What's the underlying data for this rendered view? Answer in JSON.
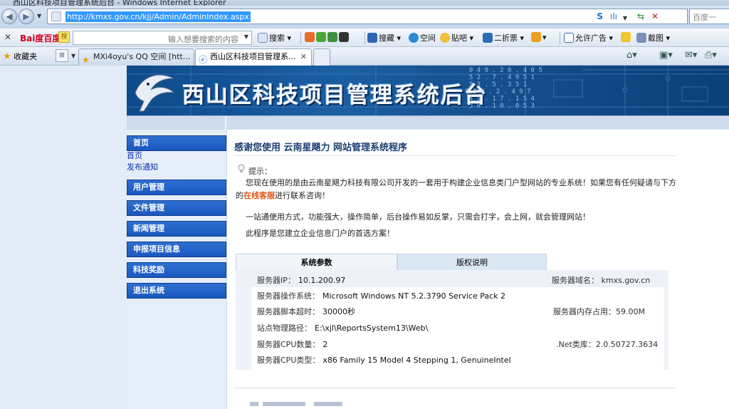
{
  "window": {
    "title": "西山区科技项目管理系统后台 - Windows Internet Explorer"
  },
  "address_bar": {
    "url": "http://kmxs.gov.cn/kjj/Admin/AdminIndex.aspx",
    "search_placeholder": "百度一"
  },
  "baidu_toolbar": {
    "logo": "Bai度百度",
    "input_placeholder": "输入想要搜索的内容",
    "search_label": "搜索",
    "news_label": "搜藏",
    "space_label": "空间",
    "tieba_label": "贴吧",
    "discount_label": "二折票",
    "allow_ads_label": "允许广告",
    "screenshot_label": "截图"
  },
  "favorites_bar": {
    "favorites_label": "收藏夹",
    "tabs": [
      {
        "label": "MXi4oyu's QQ 空间 [htt..."
      },
      {
        "label": "西山区科技项目管理系..."
      }
    ]
  },
  "banner": {
    "title": "西山区科技项目管理系统后台",
    "digits": "  0 4 9 . 2 0 . 4 0 5\n  5 2 . 7 . 4 9 5 1\n  5 3 . 5 . 3 5 1\n 1 5 9 . 2 . 4 9 7\n  4 5 . 1 7 . 1 5 4\n  3 8 . 1 0 . 0 5 3"
  },
  "sidebar": {
    "home_head": "首页",
    "sub_home": "首页",
    "sub_notice": "发布通知",
    "user_mgmt": "用户管理",
    "file_mgmt": "文件管理",
    "news_mgmt": "新闻管理",
    "project_info": "申报项目信息",
    "tech_award": "科技奖励",
    "logout": "退出系统"
  },
  "content": {
    "welcome": "感谢您使用 云南星飓力 网站管理系统程序",
    "tip_label": "提示：",
    "para1_a": "您现在使用的是由云南星飓力科技有限公司开发的一套用于构建企业信息类门户型网站的专业系统！如果您有任何疑请与下方的",
    "para1_link": "在线客服",
    "para1_b": "进行联系咨询！",
    "para2": "一站通使用方式，功能强大，操作简单，后台操作易如反掌，只需会打字，会上网，就会管理网站！",
    "para3": "此程序是您建立企业信息门户的首选方案！"
  },
  "info_tabs": {
    "params": "系统参数",
    "copyright": "版权说明"
  },
  "server_info": {
    "ip_label": "服务器IP：",
    "ip": "10.1.200.97",
    "domain_label": "服务器域名：",
    "domain": "kmxs.gov.cn",
    "os_label": "服务器操作系统：",
    "os": "Microsoft Windows NT 5.2.3790 Service Pack 2",
    "timeout_label": "服务器脚本超时：",
    "timeout": "30000秒",
    "memory_label": "服务器内存占用：",
    "memory": "59.00M",
    "path_label": "站点物理路径：",
    "path": "E:\\xjl\\ReportsSystem13\\Web\\",
    "cpu_count_label": "服务器CPU数量：",
    "cpu_count": "2",
    "net_label": ".Net类库：",
    "net": "2.0.50727.3634",
    "cpu_type_label": "服务器CPU类型：",
    "cpu_type": "x86 Family 15 Model 4 Stepping 1, GenuineIntel"
  }
}
